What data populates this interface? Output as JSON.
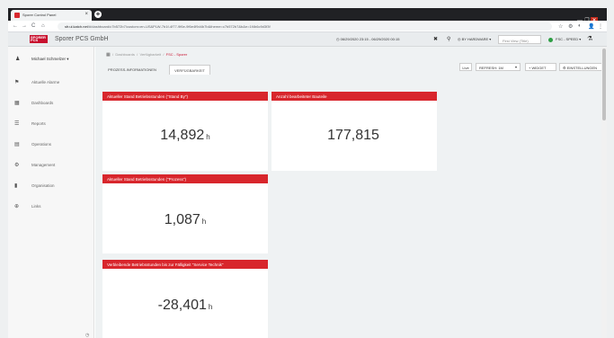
{
  "browser": {
    "tab_title": "Sporer Control Panel",
    "tab_close": "×",
    "new_tab": "+",
    "url_host": "sfr.ui.katch.net",
    "url_rest": "/#/dashboard/c7b572b7/custom=en-US&PLW-7b1f-4f77-9f6e-9f6e4f9d4b7b&theme=c7b572b7&b&e=1f4b6c9d3f3f",
    "back": "←",
    "forward": "→",
    "reload": "C",
    "home": "⌂",
    "lock": "●",
    "ext_icons": [
      "☆",
      "⚙",
      "◐",
      "👤",
      "⋮"
    ],
    "win_min": "—",
    "win_max": "❐",
    "win_close": "✕"
  },
  "header": {
    "logo_line1": "SPORER",
    "logo_line2": "PCS",
    "company": "Sporer PCS GmbH",
    "date_range": "◷ 06/29/2020 23:15 - 06/29/2020 00:15",
    "close_icon": "✖",
    "pin_icon": "⚲",
    "hardware": "◎ BY HARDWARE ▾",
    "first_view": "First View (Title)",
    "speed": "FSC - SPEED ▾",
    "share_icon": "⚗"
  },
  "sidebar": {
    "user_name": "Michael Schmelzer ▾",
    "items": [
      {
        "icon": "⚑",
        "label": "Aktuelle Alarme"
      },
      {
        "icon": "▦",
        "label": "Dashboards"
      },
      {
        "icon": "☰",
        "label": "Reports"
      },
      {
        "icon": "▤",
        "label": "Operations"
      },
      {
        "icon": "⚙",
        "label": "Management"
      },
      {
        "icon": "▮",
        "label": "Organisation"
      },
      {
        "icon": "⊕",
        "label": "Links"
      }
    ],
    "footer_icon": "◷"
  },
  "breadcrumb": {
    "home_icon": "▦",
    "sep": "/",
    "items": [
      "Dashboards",
      "Verfügbarkeit"
    ],
    "active": "FSC - Sporer"
  },
  "tabs": [
    {
      "label": "PROZESS-INFORMATIONEN",
      "active": false
    },
    {
      "label": "VERFÜGBARKEIT",
      "active": true
    }
  ],
  "controls": {
    "live": "Live",
    "refresh": "REFRESH: 1M",
    "chevron": "▾",
    "add_widget": "+ WIDGET",
    "settings": "⚙ EINSTELLUNGEN"
  },
  "widgets": [
    {
      "title": "Aktueller Stand Betriebsstunden (\"Stand By\")",
      "value": "14,892",
      "unit": "h"
    },
    {
      "title": "Anzahl bearbeiteter Bauteile",
      "value": "177,815",
      "unit": ""
    },
    {
      "title": "Aktueller Stand Betriebsstunden (\"Prozess\")",
      "value": "1,087",
      "unit": "h"
    },
    {
      "title": "Verbleibende Betriebsstunden bis zur Fälligkeit \"Service Technik\"",
      "value": "-28,401",
      "unit": "h"
    }
  ],
  "colors": {
    "accent": "#d8262c",
    "brand": "#c8102e",
    "status_green": "#2e9e44"
  }
}
